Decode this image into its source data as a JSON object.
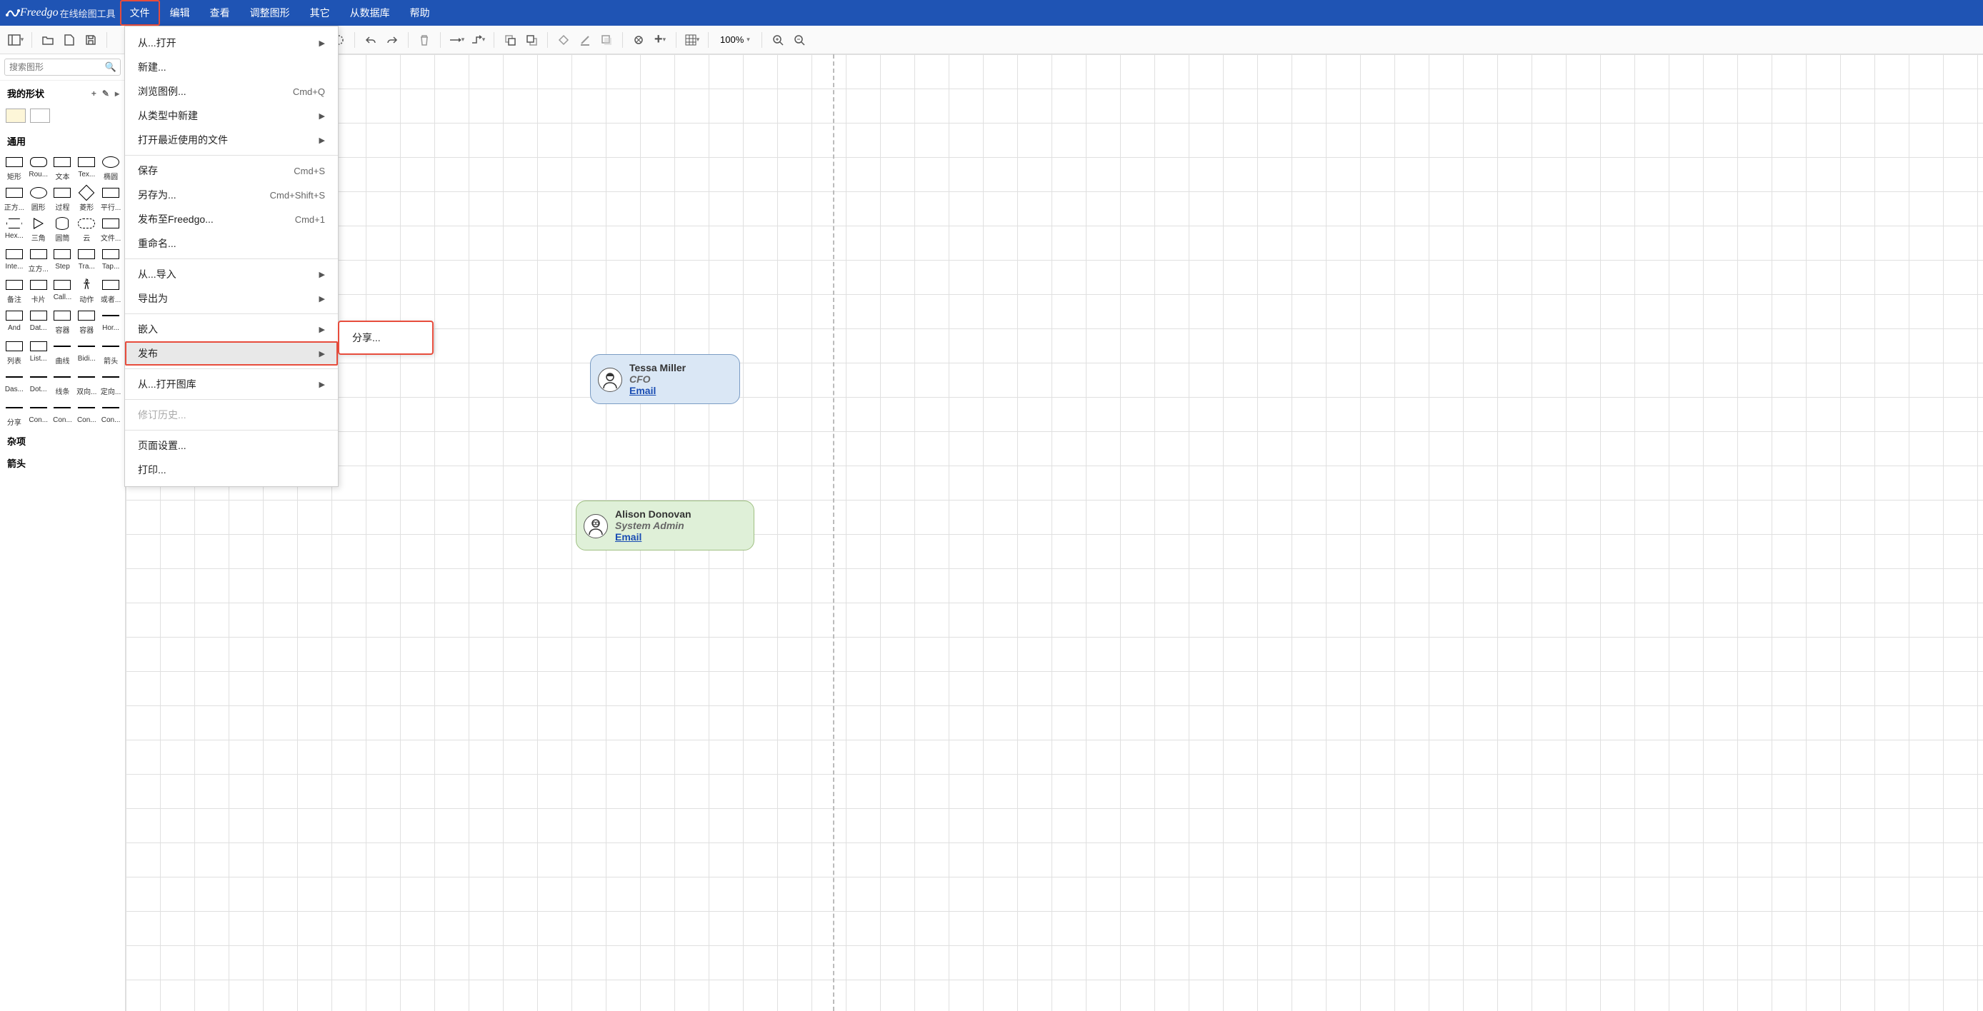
{
  "app": {
    "name": "Freedgo",
    "subtitle": "在线绘图工具"
  },
  "menubar": [
    "文件",
    "编辑",
    "查看",
    "调整图形",
    "其它",
    "从数据库",
    "帮助"
  ],
  "toolbar": {
    "zoom": "100%"
  },
  "sidebar": {
    "search_placeholder": "搜索图形",
    "my_shapes": "我的形状",
    "categories": {
      "general": "通用",
      "misc": "杂项",
      "arrows": "箭头"
    },
    "shapes": [
      [
        "矩形",
        "Rou...",
        "文本",
        "Tex...",
        "椭圆"
      ],
      [
        "正方...",
        "圆形",
        "过程",
        "菱形",
        "平行..."
      ],
      [
        "Hex...",
        "三角",
        "圆筒",
        "云",
        "文件..."
      ],
      [
        "Inte...",
        "立方...",
        "Step",
        "Tra...",
        "Tap..."
      ],
      [
        "备注",
        "卡片",
        "Call...",
        "动作",
        "或者..."
      ],
      [
        "And",
        "Dat...",
        "容器",
        "容器",
        "Hor..."
      ],
      [
        "列表",
        "List...",
        "曲线",
        "Bidi...",
        "箭头"
      ],
      [
        "Das...",
        "Dot...",
        "线条",
        "双向...",
        "定向..."
      ],
      [
        "分享",
        "Con...",
        "Con...",
        "Con...",
        "Con..."
      ]
    ]
  },
  "file_menu": [
    {
      "label": "从...打开",
      "arrow": true
    },
    {
      "label": "新建..."
    },
    {
      "label": "浏览图例...",
      "shortcut": "Cmd+Q"
    },
    {
      "label": "从类型中新建",
      "arrow": true
    },
    {
      "label": "打开最近使用的文件",
      "arrow": true
    },
    {
      "sep": true
    },
    {
      "label": "保存",
      "shortcut": "Cmd+S"
    },
    {
      "label": "另存为...",
      "shortcut": "Cmd+Shift+S"
    },
    {
      "label": "发布至Freedgo...",
      "shortcut": "Cmd+1"
    },
    {
      "label": "重命名..."
    },
    {
      "sep": true
    },
    {
      "label": "从...导入",
      "arrow": true
    },
    {
      "label": "导出为",
      "arrow": true
    },
    {
      "sep": true
    },
    {
      "label": "嵌入",
      "arrow": true
    },
    {
      "label": "发布",
      "arrow": true,
      "highlighted": true
    },
    {
      "sep": true
    },
    {
      "label": "从...打开图库",
      "arrow": true
    },
    {
      "sep": true
    },
    {
      "label": "修订历史...",
      "disabled": true
    },
    {
      "sep": true
    },
    {
      "label": "页面设置..."
    },
    {
      "label": "打印..."
    }
  ],
  "publish_submenu": [
    {
      "label": "分享..."
    }
  ],
  "canvas": {
    "card1": {
      "name": "Tessa Miller",
      "title": "CFO",
      "email": "Email"
    },
    "card2": {
      "name": "Alison Donovan",
      "title": "System Admin",
      "email": "Email"
    }
  }
}
